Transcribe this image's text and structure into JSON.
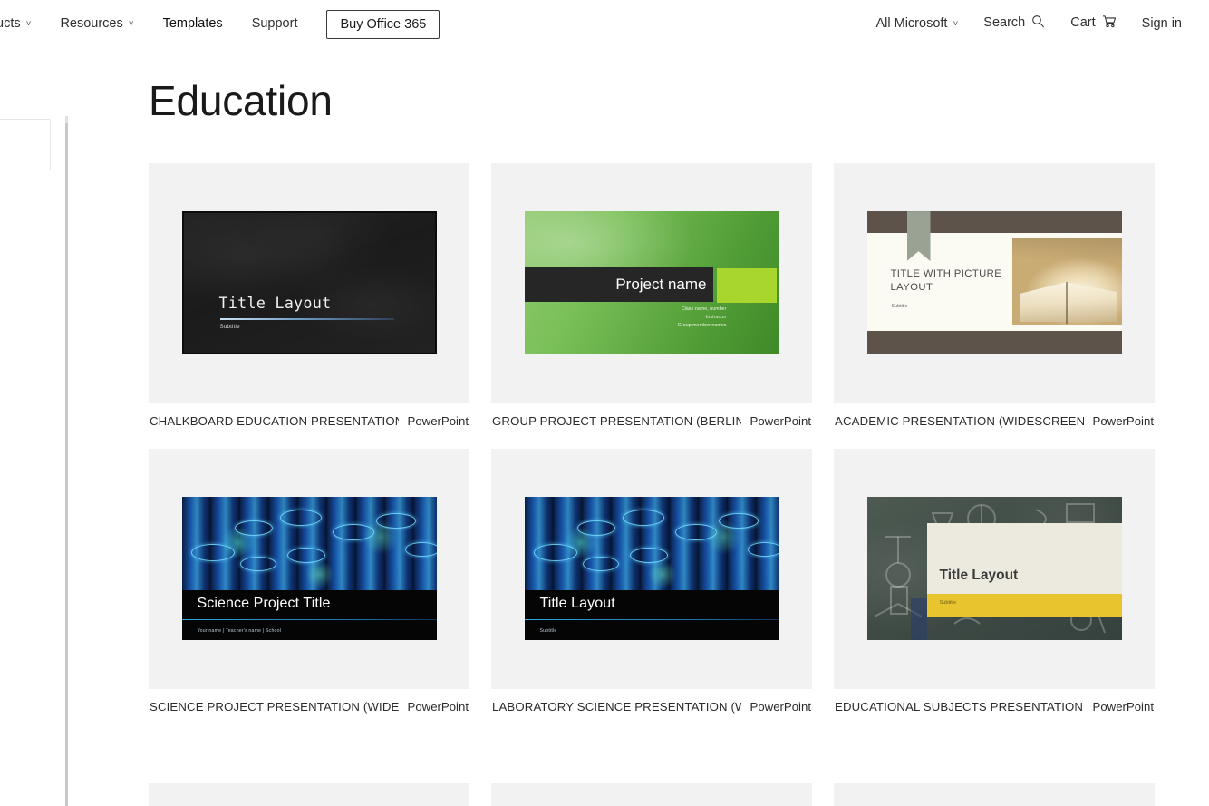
{
  "nav": {
    "left_items": [
      {
        "label": "ucts",
        "has_caret": true,
        "active": false,
        "name": "nav-item-products"
      },
      {
        "label": "Resources",
        "has_caret": true,
        "active": false,
        "name": "nav-item-resources"
      },
      {
        "label": "Templates",
        "has_caret": false,
        "active": true,
        "name": "nav-item-templates"
      },
      {
        "label": "Support",
        "has_caret": false,
        "active": false,
        "name": "nav-item-support"
      }
    ],
    "buy_button": "Buy Office 365",
    "right_items": [
      {
        "label": "All Microsoft",
        "icon": "chevron-down-icon",
        "name": "nav-item-all-microsoft"
      },
      {
        "label": "Search",
        "icon": "search-icon",
        "name": "nav-item-search"
      },
      {
        "label": "Cart",
        "icon": "cart-icon",
        "name": "nav-item-cart"
      },
      {
        "label": "Sign in",
        "icon": "",
        "name": "nav-item-sign-in"
      }
    ]
  },
  "page": {
    "title": "Education"
  },
  "colors": {
    "card_background": "#f2f2f2",
    "accent_green": "#a8d62c",
    "accent_yellow": "#e8c52e",
    "accent_brown": "#5d534b",
    "page_background": "#ffffff"
  },
  "templates": [
    {
      "name": "CHALKBOARD EDUCATION PRESENTATION (...",
      "app": "PowerPoint",
      "thumb": {
        "style": "chalkboard",
        "title": "Title Layout",
        "subtitle": "Subtitle"
      }
    },
    {
      "name": "GROUP PROJECT PRESENTATION (BERLIN T...",
      "app": "PowerPoint",
      "thumb": {
        "style": "green-project",
        "title": "Project name",
        "meta_lines": [
          "Class name, number",
          "Instructor",
          "Group member names"
        ]
      }
    },
    {
      "name": "ACADEMIC PRESENTATION (WIDESCREEN)",
      "app": "PowerPoint",
      "thumb": {
        "style": "academic",
        "title": "TITLE WITH PICTURE LAYOUT",
        "subtitle": "Subtitle"
      }
    },
    {
      "name": "SCIENCE PROJECT PRESENTATION (WIDESC...",
      "app": "PowerPoint",
      "thumb": {
        "style": "test-tubes",
        "title": "Science Project Title",
        "subtitle": "Your name | Teacher's name | School"
      }
    },
    {
      "name": "LABORATORY SCIENCE PRESENTATION (WID...",
      "app": "PowerPoint",
      "thumb": {
        "style": "test-tubes",
        "title": "Title Layout",
        "subtitle": "Subtitle"
      }
    },
    {
      "name": "EDUCATIONAL SUBJECTS PRESENTATION, C...",
      "app": "PowerPoint",
      "thumb": {
        "style": "educational-subjects",
        "title": "Title Layout",
        "subtitle": "Subtitle"
      }
    }
  ]
}
